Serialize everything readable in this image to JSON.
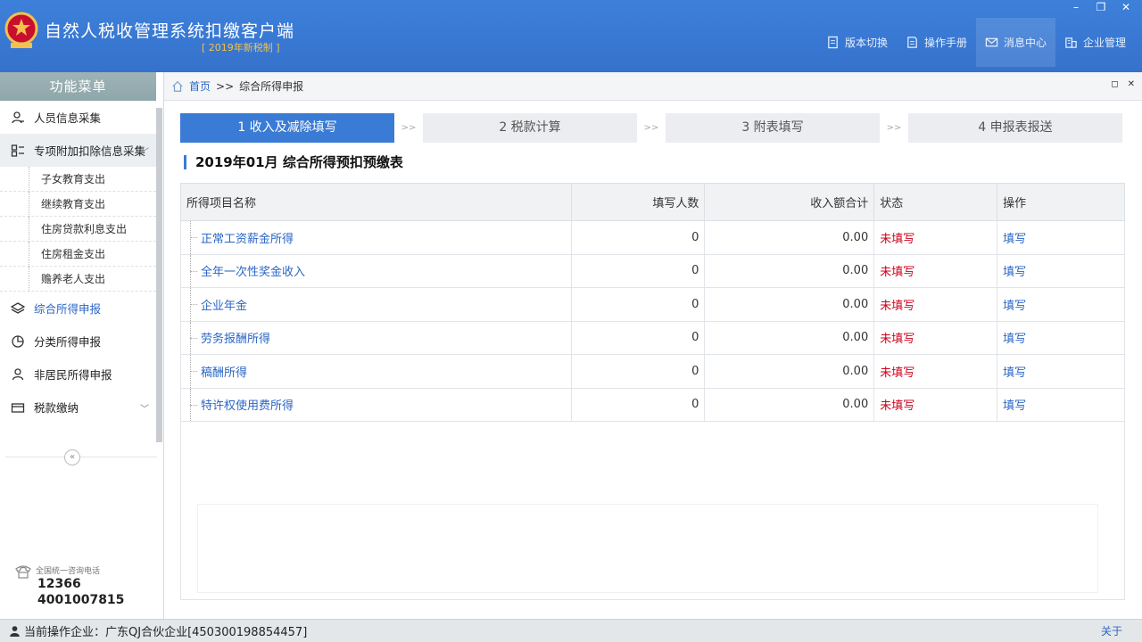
{
  "app": {
    "title": "自然人税收管理系统扣缴客户端",
    "subtitle": "[ 2019年新税制 ]"
  },
  "window_controls": {
    "minimize": "–",
    "restore": "❐",
    "close": "✕"
  },
  "top_nav": [
    {
      "label": "版本切换",
      "icon": "document-icon"
    },
    {
      "label": "操作手册",
      "icon": "book-icon"
    },
    {
      "label": "消息中心",
      "icon": "mail-icon"
    },
    {
      "label": "企业管理",
      "icon": "building-icon"
    }
  ],
  "sidebar": {
    "header": "功能菜单",
    "items": [
      {
        "label": "人员信息采集",
        "icon": "person-icon"
      },
      {
        "label": "专项附加扣除信息采集",
        "icon": "grid-list-icon"
      },
      {
        "label": "综合所得申报",
        "icon": "layers-icon"
      },
      {
        "label": "分类所得申报",
        "icon": "pie-icon"
      },
      {
        "label": "非居民所得申报",
        "icon": "user-icon"
      },
      {
        "label": "税款缴纳",
        "icon": "wallet-icon"
      }
    ],
    "sub_items": [
      "子女教育支出",
      "继续教育支出",
      "住房贷款利息支出",
      "住房租金支出",
      "赡养老人支出"
    ],
    "collapse": "«",
    "hotline": {
      "label": "全国统一咨询电话",
      "numbers": [
        "12366",
        "4001007815"
      ]
    }
  },
  "breadcrumb": {
    "home": "首页",
    "sep": ">>",
    "current": "综合所得申报"
  },
  "steps": [
    "1 收入及减除填写",
    "2 税款计算",
    "3 附表填写",
    "4 申报表报送"
  ],
  "step_sep": ">>",
  "section_title": "2019年01月  综合所得预扣预缴表",
  "table": {
    "headers": [
      "所得项目名称",
      "填写人数",
      "收入额合计",
      "状态",
      "操作"
    ],
    "rows": [
      {
        "name": "正常工资薪金所得",
        "count": "0",
        "amount": "0.00",
        "status": "未填写",
        "op": "填写"
      },
      {
        "name": "全年一次性奖金收入",
        "count": "0",
        "amount": "0.00",
        "status": "未填写",
        "op": "填写"
      },
      {
        "name": "企业年金",
        "count": "0",
        "amount": "0.00",
        "status": "未填写",
        "op": "填写"
      },
      {
        "name": "劳务报酬所得",
        "count": "0",
        "amount": "0.00",
        "status": "未填写",
        "op": "填写"
      },
      {
        "name": "稿酬所得",
        "count": "0",
        "amount": "0.00",
        "status": "未填写",
        "op": "填写"
      },
      {
        "name": "特许权使用费所得",
        "count": "0",
        "amount": "0.00",
        "status": "未填写",
        "op": "填写"
      }
    ]
  },
  "status_bar": {
    "text": "当前操作企业：广东QJ合伙企业[450300198854457]",
    "about": "关于"
  },
  "colors": {
    "primary": "#3a7bd5",
    "link": "#2b66c4",
    "status_unfilled": "#d0021b"
  }
}
